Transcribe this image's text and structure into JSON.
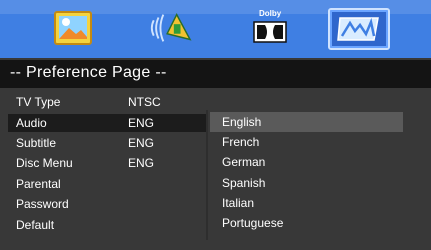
{
  "header": {
    "tabs": [
      {
        "name": "general-setup",
        "icon": "landscape-icon"
      },
      {
        "name": "audio-setup",
        "icon": "speaker-icon"
      },
      {
        "name": "dolby-setup",
        "icon": "dolby-icon",
        "label": "Dolby"
      },
      {
        "name": "preference-setup",
        "icon": "preference-icon",
        "selected": true
      }
    ]
  },
  "page": {
    "title": "-- Preference Page --"
  },
  "settings": [
    {
      "label": "TV Type",
      "value": "NTSC"
    },
    {
      "label": "Audio",
      "value": "ENG"
    },
    {
      "label": "Subtitle",
      "value": "ENG"
    },
    {
      "label": "Disc Menu",
      "value": "ENG"
    },
    {
      "label": "Parental",
      "value": ""
    },
    {
      "label": "Password",
      "value": ""
    },
    {
      "label": "Default",
      "value": ""
    }
  ],
  "options": [
    "English",
    "French",
    "German",
    "Spanish",
    "Italian",
    "Portuguese"
  ],
  "colors": {
    "topbar": "#3f7fe3",
    "panel": "#383838",
    "titlebar": "#141414",
    "highlight": "#5a5a5a"
  }
}
